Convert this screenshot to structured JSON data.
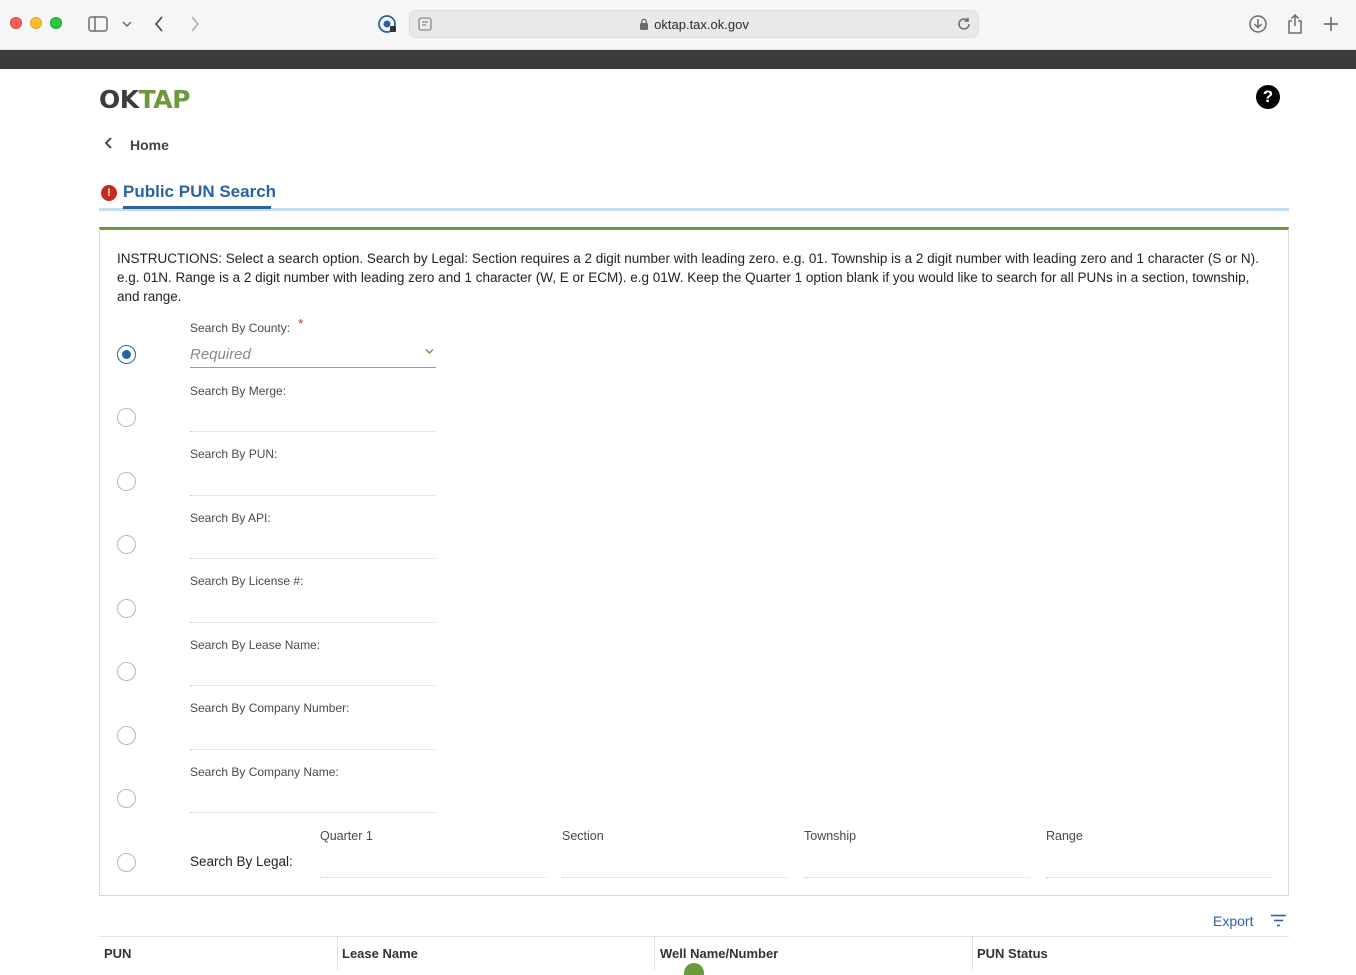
{
  "browser": {
    "url": "oktap.tax.ok.gov"
  },
  "header": {
    "logo_ok": "OK",
    "logo_tap": "TAP",
    "help_glyph": "?"
  },
  "nav": {
    "back_label": "Home"
  },
  "page": {
    "title": "Public PUN Search",
    "error_glyph": "!"
  },
  "form": {
    "instructions": "INSTRUCTIONS: Select a search option. Search by Legal: Section requires a 2 digit number with leading zero. e.g. 01. Township is a 2 digit number with leading zero and 1 character (S or N). e.g. 01N. Range is a 2 digit number with leading zero and 1 character (W, E or ECM). e.g 01W. Keep the Quarter 1 option blank if you would like to search for all PUNs in a section, township, and range.",
    "county": {
      "label": "Search By County:",
      "required_mark": "*",
      "placeholder": "Required",
      "selected": true
    },
    "merge_label": "Search By Merge:",
    "pun_label": "Search By PUN:",
    "api_label": "Search By API:",
    "license_label": "Search By License #:",
    "lease_name_label": "Search By Lease Name:",
    "company_number_label": "Search By Company Number:",
    "company_name_label": "Search By Company Name:",
    "legal": {
      "label": "Search By Legal:",
      "quarter1": "Quarter 1",
      "section": "Section",
      "township": "Township",
      "range": "Range"
    }
  },
  "results": {
    "export_label": "Export",
    "columns": [
      "PUN",
      "Lease Name",
      "Well Name/Number",
      "PUN Status"
    ]
  },
  "colors": {
    "brand_green": "#6c9a3a",
    "link_blue": "#2a62a3",
    "error_red": "#c8281f"
  }
}
